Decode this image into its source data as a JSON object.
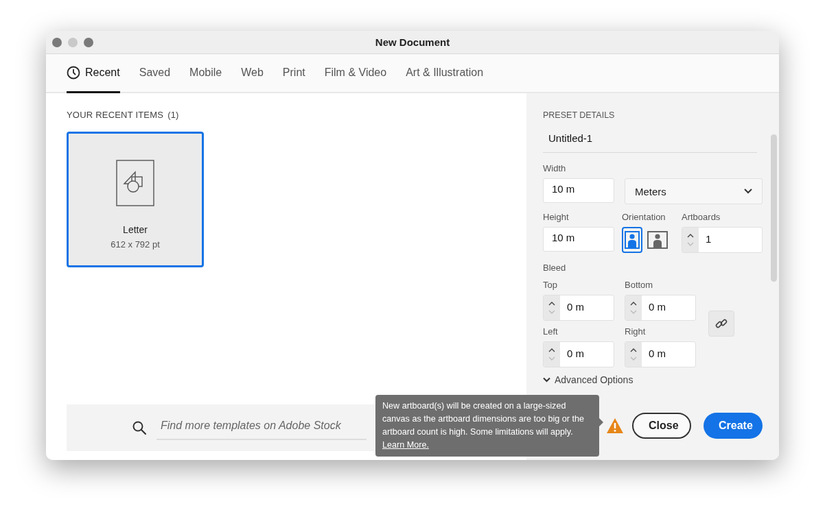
{
  "window": {
    "title": "New Document"
  },
  "tabs": [
    {
      "label": "Recent",
      "selected": true
    },
    {
      "label": "Saved",
      "selected": false
    },
    {
      "label": "Mobile",
      "selected": false
    },
    {
      "label": "Web",
      "selected": false
    },
    {
      "label": "Print",
      "selected": false
    },
    {
      "label": "Film & Video",
      "selected": false
    },
    {
      "label": "Art & Illustration",
      "selected": false
    }
  ],
  "recent": {
    "heading": "YOUR RECENT ITEMS",
    "count": "(1)",
    "items": [
      {
        "name": "Letter",
        "size": "612 x 792 pt",
        "selected": true
      }
    ]
  },
  "search": {
    "placeholder": "Find more templates on Adobe Stock"
  },
  "preset": {
    "heading": "PRESET DETAILS",
    "name": "Untitled-1",
    "width": {
      "label": "Width",
      "value": "10 m"
    },
    "units": {
      "value": "Meters"
    },
    "height": {
      "label": "Height",
      "value": "10 m"
    },
    "orientation": {
      "label": "Orientation",
      "options": [
        {
          "kind": "portrait",
          "selected": true
        },
        {
          "kind": "landscape",
          "selected": false
        }
      ]
    },
    "artboards": {
      "label": "Artboards",
      "value": "1"
    },
    "bleed": {
      "label": "Bleed",
      "fields": [
        {
          "label": "Top",
          "value": "0 m"
        },
        {
          "label": "Bottom",
          "value": "0 m"
        },
        {
          "label": "Left",
          "value": "0 m"
        },
        {
          "label": "Right",
          "value": "0 m"
        }
      ]
    },
    "advanced": {
      "label": "Advanced Options"
    }
  },
  "tooltip": {
    "text": "New artboard(s) will be created on a large-sized canvas as the artboard dimensions are too big or the artboard count is high. Some limitations will apply.",
    "link": "Learn More."
  },
  "buttons": [
    {
      "label": "Close",
      "kind": "secondary"
    },
    {
      "label": "Create",
      "kind": "primary"
    }
  ]
}
